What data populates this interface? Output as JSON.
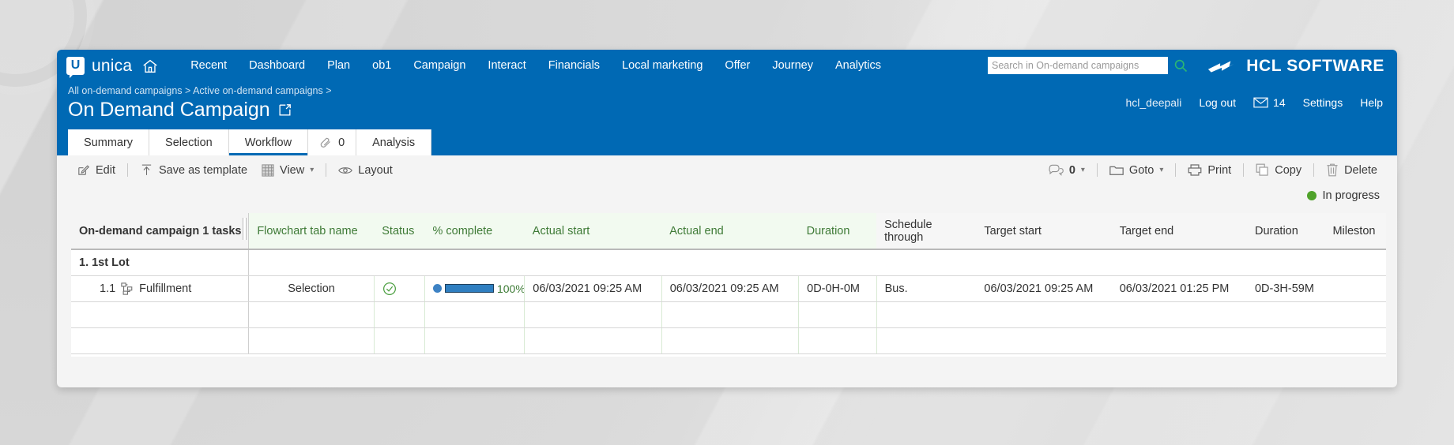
{
  "topnav": {
    "brand_letter": "U",
    "brand_name": "unica",
    "home_icon": "home-icon",
    "items": [
      {
        "label": "Recent"
      },
      {
        "label": "Dashboard"
      },
      {
        "label": "Plan"
      },
      {
        "label": "ob1"
      },
      {
        "label": "Campaign"
      },
      {
        "label": "Interact"
      },
      {
        "label": "Financials"
      },
      {
        "label": "Local marketing"
      },
      {
        "label": "Offer"
      },
      {
        "label": "Journey"
      },
      {
        "label": "Analytics"
      }
    ],
    "search": {
      "placeholder": "Search in On-demand campaigns",
      "value": "",
      "icon": "search-icon"
    },
    "vendor": {
      "logo_icon": "hcl-logo-icon",
      "text": "HCL SOFTWARE"
    }
  },
  "header": {
    "breadcrumb": "All on-demand campaigns > Active on-demand campaigns >",
    "title": "On Demand Campaign",
    "title_external_icon": "external-link-icon",
    "user": "hcl_deepali",
    "logout": "Log out",
    "mail_icon": "envelope-icon",
    "mail_count": "14",
    "settings": "Settings",
    "help": "Help"
  },
  "tabs": [
    {
      "label": "Summary",
      "active": false,
      "icon": null
    },
    {
      "label": "Selection",
      "active": false,
      "icon": null
    },
    {
      "label": "Workflow",
      "active": true,
      "icon": null
    },
    {
      "label": "0",
      "active": false,
      "icon": "paperclip-icon"
    },
    {
      "label": "Analysis",
      "active": false,
      "icon": null
    }
  ],
  "toolbar": {
    "left": [
      {
        "label": "Edit",
        "icon": "pencil-square-icon"
      },
      {
        "label": "Save as template",
        "icon": "upload-arrow-icon"
      },
      {
        "label": "View",
        "icon": "grid-icon",
        "caret": true
      },
      {
        "label": "Layout",
        "icon": "eye-icon"
      }
    ],
    "right": [
      {
        "label": "0",
        "icon": "comment-icon",
        "caret": true
      },
      {
        "label": "Goto",
        "icon": "folder-icon",
        "caret": true
      },
      {
        "label": "Print",
        "icon": "printer-icon"
      },
      {
        "label": "Copy",
        "icon": "copy-icon"
      },
      {
        "label": "Delete",
        "icon": "trash-icon"
      }
    ]
  },
  "status": {
    "label": "In progress",
    "color": "#4fa22a"
  },
  "table": {
    "columns": [
      {
        "label": "On-demand campaign 1 tasks",
        "style": "first"
      },
      {
        "label": "Flowchart tab name",
        "style": "green"
      },
      {
        "label": "Status",
        "style": "green"
      },
      {
        "label": "% complete",
        "style": "green"
      },
      {
        "label": "Actual start",
        "style": "green"
      },
      {
        "label": "Actual end",
        "style": "green"
      },
      {
        "label": "Duration",
        "style": "green"
      },
      {
        "label": "Schedule through",
        "style": "plain"
      },
      {
        "label": "Target start",
        "style": "plain"
      },
      {
        "label": "Target end",
        "style": "plain"
      },
      {
        "label": "Duration",
        "style": "plain"
      },
      {
        "label": "Mileston",
        "style": "plain"
      }
    ],
    "group_row": {
      "label": "1. 1st Lot"
    },
    "rows": [
      {
        "num": "1.1",
        "icon": "flowchart-icon",
        "name": "Fulfillment",
        "flowchart_tab_name": "Selection",
        "status_icon": "check-circle-icon",
        "percent_complete": "100%",
        "percent_value": 100,
        "actual_start": "06/03/2021 09:25 AM",
        "actual_end": "06/03/2021 09:25 AM",
        "actual_duration": "0D-0H-0M",
        "schedule_through": "Bus.",
        "target_start": "06/03/2021 09:25 AM",
        "target_end": "06/03/2021 01:25 PM",
        "target_duration": "0D-3H-59M",
        "milestone": ""
      }
    ],
    "empty_rows": 2
  }
}
